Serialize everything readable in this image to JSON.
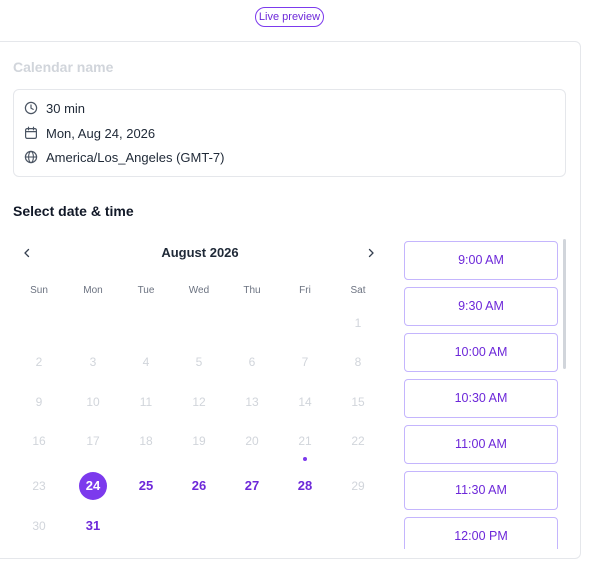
{
  "header": {
    "badge": "Live preview"
  },
  "booking": {
    "calendar_name_placeholder": "Calendar name",
    "duration": "30 min",
    "date": "Mon, Aug 24, 2026",
    "timezone": "America/Los_Angeles (GMT-7)",
    "section_title": "Select date & time"
  },
  "calendar": {
    "month_label": "August 2026",
    "weekdays": [
      "Sun",
      "Mon",
      "Tue",
      "Wed",
      "Thu",
      "Fri",
      "Sat"
    ],
    "first_weekday_index": 6,
    "days_in_month": 31,
    "selected_day": 24,
    "available_days": [
      25,
      26,
      27,
      28,
      31
    ],
    "marked_days": [
      21
    ]
  },
  "time_slots": [
    "9:00 AM",
    "9:30 AM",
    "10:00 AM",
    "10:30 AM",
    "11:00 AM",
    "11:30 AM",
    "12:00 PM"
  ],
  "colors": {
    "accent": "#7c3aed",
    "accent_text": "#6d28d9",
    "slot_border": "#c4b5fd",
    "disabled": "#d1d5db"
  },
  "icons": {
    "prev": "chevron-left-icon",
    "next": "chevron-right-icon",
    "duration": "clock-icon",
    "date": "calendar-icon",
    "timezone": "globe-icon"
  }
}
